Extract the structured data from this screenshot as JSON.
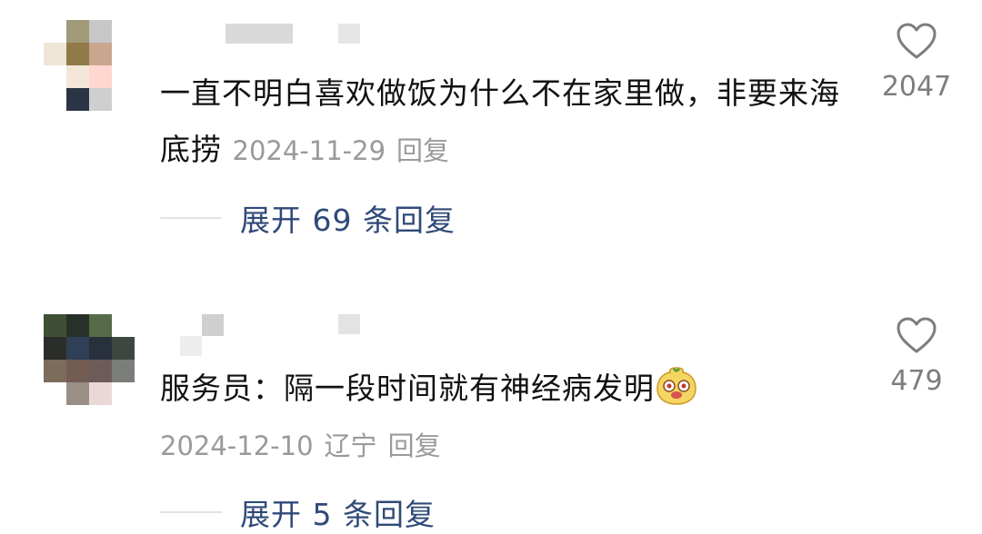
{
  "comments": [
    {
      "text": "一直不明白喜欢做饭为什么不在家里做，非要来海底捞",
      "date": "2024-11-29",
      "location": "",
      "reply_label": "回复",
      "likes": "2047",
      "expand_label": "展开 69 条回复",
      "avatar_colors": [
        "#ffffff",
        "#a09a78",
        "#c7c7c7",
        "#ffffff",
        "#efe6d8",
        "#8f7a48",
        "#c9a78f",
        "#ffffff",
        "#ffffff",
        "#f4e7da",
        "#ffd7cf",
        "#ffffff",
        "#ffffff",
        "#2b3444",
        "#cfcfcf",
        "#ffffff"
      ]
    },
    {
      "text": "服务员：隔一段时间就有神经病发明",
      "date": "2024-12-10",
      "location": "辽宁",
      "reply_label": "回复",
      "likes": "479",
      "expand_label": "展开 5 条回复",
      "emoji": "sticker-face-icon",
      "avatar_colors": [
        "#3f4f35",
        "#27312a",
        "#566b48",
        "#ffffff",
        "#2a2d29",
        "#2f3f55",
        "#27303b",
        "#3e4640",
        "#7d6b5c",
        "#735d53",
        "#6d5b5a",
        "#7a7d78",
        "#ffffff",
        "#9a8f87",
        "#ead8d8",
        "#ffffff"
      ]
    }
  ],
  "colors": {
    "text": "#111111",
    "meta": "#9a9a9a",
    "expand": "#2f4a78"
  }
}
